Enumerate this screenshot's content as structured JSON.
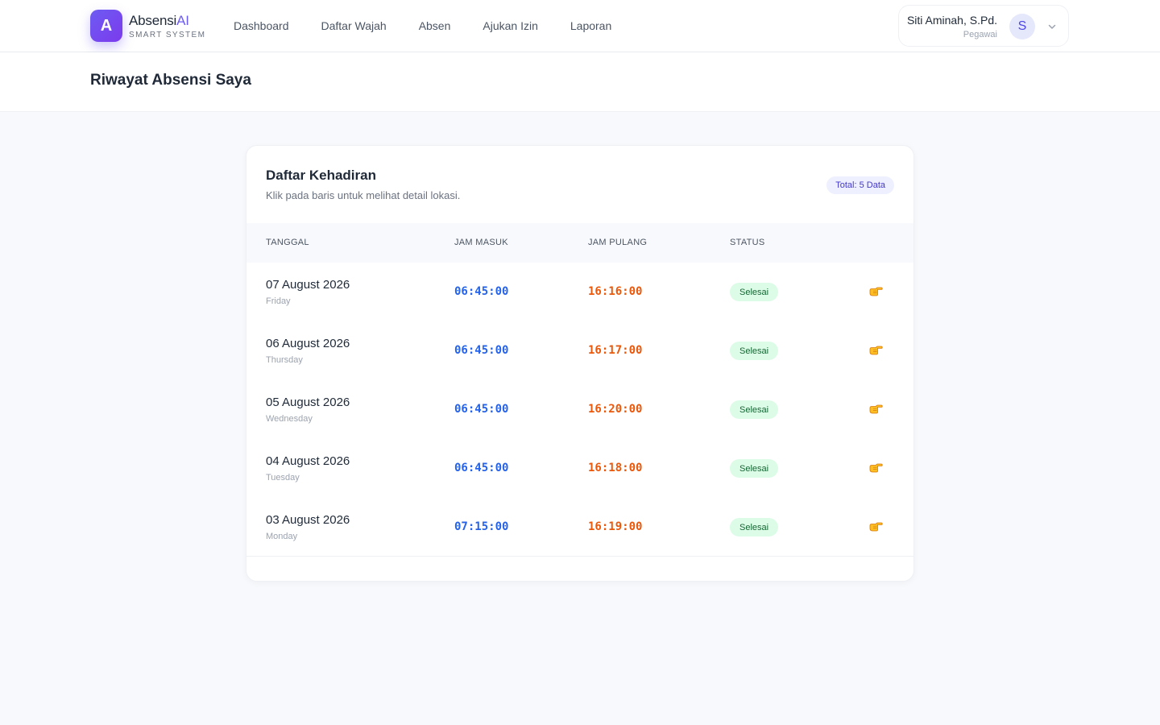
{
  "brand": {
    "logo_letter": "A",
    "name_main": "Absensi",
    "name_accent": "AI",
    "subtitle": "SMART SYSTEM",
    "accent_color": "#6d5cf2"
  },
  "nav": {
    "items": [
      "Dashboard",
      "Daftar Wajah",
      "Absen",
      "Ajukan Izin",
      "Laporan"
    ]
  },
  "user": {
    "name": "Siti Aminah, S.Pd.",
    "role": "Pegawai",
    "avatar_letter": "S",
    "menu_icon": "chevron-down-icon"
  },
  "page": {
    "title": "Riwayat Absensi Saya"
  },
  "card": {
    "title": "Daftar Kehadiran",
    "subtitle": "Klik pada baris untuk melihat detail lokasi.",
    "total_badge": "Total: 5 Data"
  },
  "table": {
    "headers": [
      "TANGGAL",
      "JAM MASUK",
      "JAM PULANG",
      "STATUS"
    ],
    "rows": [
      {
        "date": "07 August 2026",
        "day": "Friday",
        "in": "06:45:00",
        "out": "16:16:00",
        "status": "Selesai",
        "action_icon": "pointing-hand-icon"
      },
      {
        "date": "06 August 2026",
        "day": "Thursday",
        "in": "06:45:00",
        "out": "16:17:00",
        "status": "Selesai",
        "action_icon": "pointing-hand-icon"
      },
      {
        "date": "05 August 2026",
        "day": "Wednesday",
        "in": "06:45:00",
        "out": "16:20:00",
        "status": "Selesai",
        "action_icon": "pointing-hand-icon"
      },
      {
        "date": "04 August 2026",
        "day": "Tuesday",
        "in": "06:45:00",
        "out": "16:18:00",
        "status": "Selesai",
        "action_icon": "pointing-hand-icon"
      },
      {
        "date": "03 August 2026",
        "day": "Monday",
        "in": "07:15:00",
        "out": "16:19:00",
        "status": "Selesai",
        "action_icon": "pointing-hand-icon"
      }
    ]
  },
  "colors": {
    "time_in": "#2563eb",
    "time_out": "#ea580c",
    "status_bg": "#dcfce7",
    "status_text": "#166534"
  }
}
